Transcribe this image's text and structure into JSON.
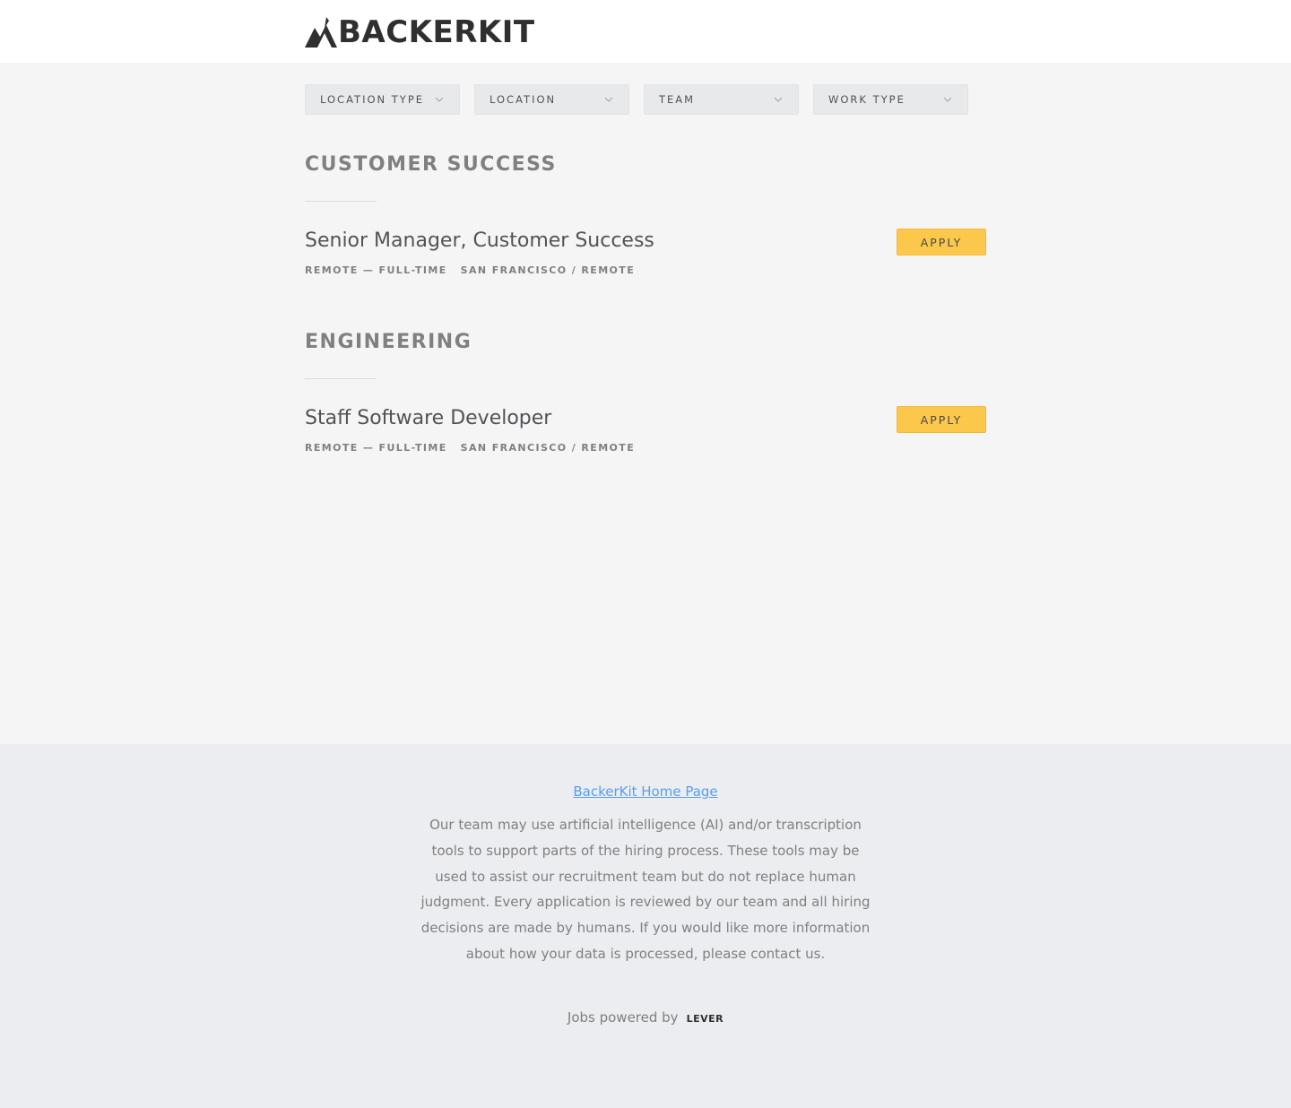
{
  "header": {
    "logo_text": "BACKERKIT"
  },
  "filters": [
    {
      "label": "LOCATION TYPE",
      "icon": "chevron-down-icon"
    },
    {
      "label": "LOCATION",
      "icon": "chevron-down-icon"
    },
    {
      "label": "TEAM",
      "icon": "chevron-down-icon"
    },
    {
      "label": "WORK TYPE",
      "icon": "chevron-down-icon"
    }
  ],
  "groups": [
    {
      "title": "CUSTOMER SUCCESS",
      "postings": [
        {
          "title": "Senior Manager, Customer Success",
          "commitment": "REMOTE — FULL-TIME",
          "location": "SAN FRANCISCO / REMOTE",
          "apply_label": "APPLY"
        }
      ]
    },
    {
      "title": "ENGINEERING",
      "postings": [
        {
          "title": "Staff Software Developer",
          "commitment": "REMOTE — FULL-TIME",
          "location": "SAN FRANCISCO / REMOTE",
          "apply_label": "APPLY"
        }
      ]
    }
  ],
  "footer": {
    "home_link": "BackerKit Home Page",
    "note": "Our team may use artificial intelligence (AI) and/or transcription tools to support parts of the hiring process. These tools may be used to assist our recruitment team but do not replace human judgment. Every application is reviewed by our team and all hiring decisions are made by humans. If you would like more information about how your data is processed, please contact us.",
    "powered_by": "Jobs powered by",
    "powered_logo": "LEVER"
  },
  "colors": {
    "background": "#f5f5f6",
    "apply_button": "#fcc84c",
    "link": "#579eee",
    "footer_bg": "#ecedf0"
  }
}
